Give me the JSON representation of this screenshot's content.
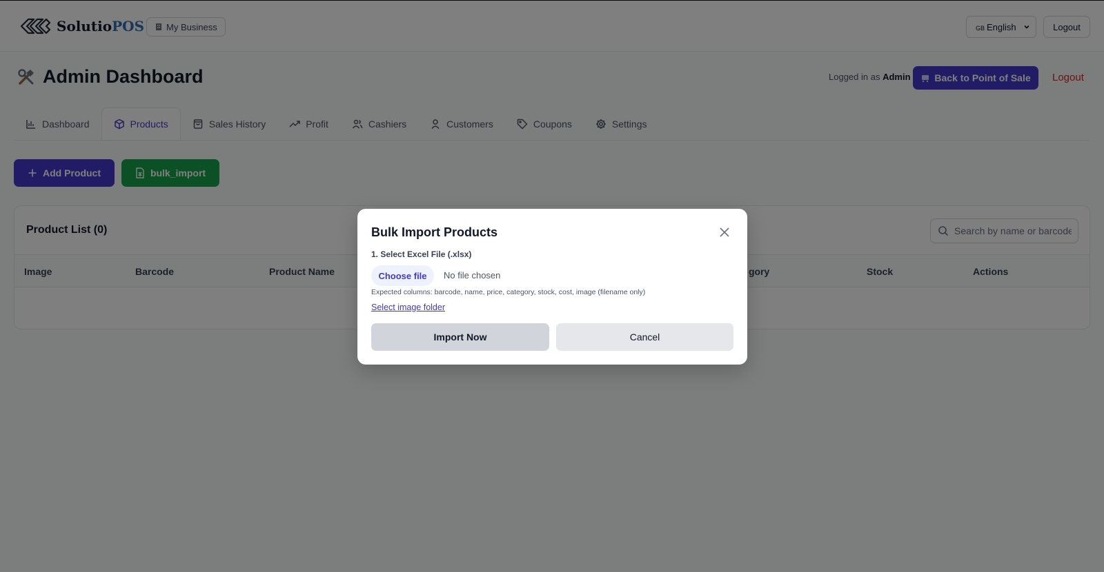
{
  "topbar": {
    "logo_main": "Solutio",
    "logo_accent": "POS",
    "business_label": "My Business",
    "language": "English",
    "language_flag": "GB",
    "logout": "Logout"
  },
  "header": {
    "title": "Admin Dashboard",
    "logged_in_prefix": "Logged in as",
    "logged_in_user": "Admin",
    "back_to_pos": "Back to Point of Sale",
    "logout": "Logout"
  },
  "tabs": [
    {
      "label": "Dashboard",
      "icon": "bar-chart-icon"
    },
    {
      "label": "Products",
      "icon": "package-icon",
      "active": true
    },
    {
      "label": "Sales History",
      "icon": "shopping-bag-icon"
    },
    {
      "label": "Profit",
      "icon": "trending-up-icon"
    },
    {
      "label": "Cashiers",
      "icon": "users-icon"
    },
    {
      "label": "Customers",
      "icon": "user-icon"
    },
    {
      "label": "Coupons",
      "icon": "tag-icon"
    },
    {
      "label": "Settings",
      "icon": "gear-icon"
    }
  ],
  "actions": {
    "add_product": "Add Product",
    "bulk_import": "bulk_import"
  },
  "product_list": {
    "title": "Product List (0)",
    "search_placeholder": "Search by name or barcode",
    "columns": [
      "Image",
      "Barcode",
      "Product Name",
      "gory",
      "Stock",
      "Actions"
    ]
  },
  "modal": {
    "title": "Bulk Import Products",
    "step_label": "1. Select Excel File (.xlsx)",
    "choose_file": "Choose file",
    "no_file": "No file chosen",
    "expected_columns": "Expected columns: barcode, name, price, category, stock, cost, image (filename only)",
    "select_image_folder": "Select image folder",
    "import_now": "Import Now",
    "cancel": "Cancel"
  },
  "colors": {
    "primary": "#4338ca",
    "success": "#16a34a",
    "danger": "#dc2626",
    "logo_accent": "#2e6fb7"
  }
}
